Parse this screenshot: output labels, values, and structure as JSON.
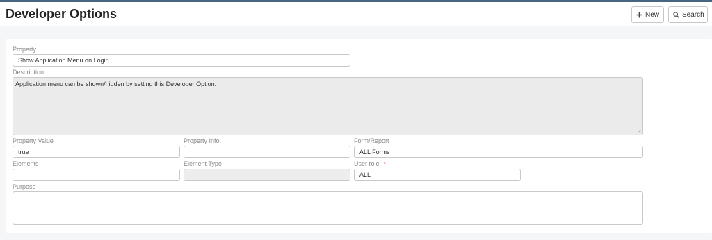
{
  "header": {
    "title": "Developer Options",
    "new_label": "New",
    "search_label": "Search"
  },
  "form": {
    "property": {
      "label": "Property",
      "value": "Show Application Menu on Login"
    },
    "description": {
      "label": "Description",
      "value": "Application menu can be shown/hidden by setting this Developer Option."
    },
    "property_value": {
      "label": "Property Value",
      "value": "true"
    },
    "property_info": {
      "label": "Property Info.",
      "value": ""
    },
    "form_report": {
      "label": "Form/Report",
      "value": "ALL Forms"
    },
    "elements": {
      "label": "Elements",
      "value": ""
    },
    "element_type": {
      "label": "Element Type",
      "value": ""
    },
    "user_role": {
      "label": "User role",
      "required_mark": "*",
      "value": "ALL"
    },
    "purpose": {
      "label": "Purpose",
      "value": ""
    }
  },
  "icons": {
    "new": "plus-icon",
    "search": "search-icon"
  }
}
